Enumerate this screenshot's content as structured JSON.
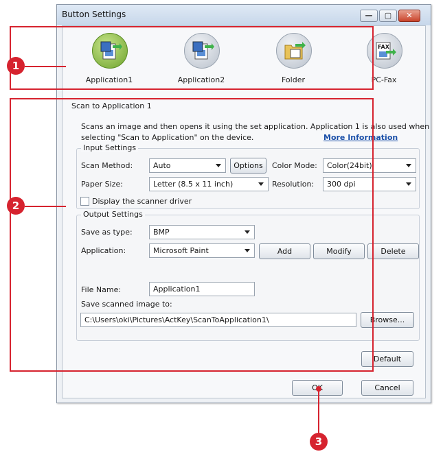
{
  "window": {
    "title": "Button Settings"
  },
  "window_buttons": {
    "minimize": "—",
    "maximize": "▢",
    "close": "✕"
  },
  "apps": [
    {
      "label": "Application1",
      "icon": "scan-to-application-icon",
      "selected": true
    },
    {
      "label": "Application2",
      "icon": "scan-to-application-icon",
      "selected": false
    },
    {
      "label": "Folder",
      "icon": "folder-icon",
      "selected": false
    },
    {
      "label": "PC-Fax",
      "icon": "fax-icon",
      "selected": false
    }
  ],
  "section": {
    "title": "Scan to Application 1",
    "desc_line1": "Scans an image and then opens it using the set application. Application 1 is also used when",
    "desc_line2": "selecting \"Scan to Application\" on the device.",
    "more_info": "More Information"
  },
  "input_settings": {
    "title": "Input Settings",
    "scan_method_label": "Scan Method:",
    "scan_method_value": "Auto",
    "options_button": "Options",
    "color_mode_label": "Color Mode:",
    "color_mode_value": "Color(24bit)",
    "paper_size_label": "Paper Size:",
    "paper_size_value": "Letter (8.5 x 11 inch)",
    "resolution_label": "Resolution:",
    "resolution_value": "300 dpi",
    "display_driver_label": "Display the scanner driver",
    "display_driver_checked": false
  },
  "output_settings": {
    "title": "Output Settings",
    "save_type_label": "Save as type:",
    "save_type_value": "BMP",
    "application_label": "Application:",
    "application_value": "Microsoft Paint",
    "add_button": "Add",
    "modify_button": "Modify",
    "delete_button": "Delete",
    "file_name_label": "File Name:",
    "file_name_value": "Application1",
    "save_to_label": "Save scanned image to:",
    "save_to_value": "C:\\Users\\oki\\Pictures\\ActKey\\ScanToApplication1\\",
    "browse_button": "Browse..."
  },
  "buttons": {
    "default": "Default",
    "ok": "OK",
    "cancel": "Cancel"
  },
  "callouts": {
    "one": "1",
    "two": "2",
    "three": "3"
  },
  "colors": {
    "callout": "#d6232f",
    "selected_app": "#6da22b",
    "link": "#1a4fa8"
  }
}
